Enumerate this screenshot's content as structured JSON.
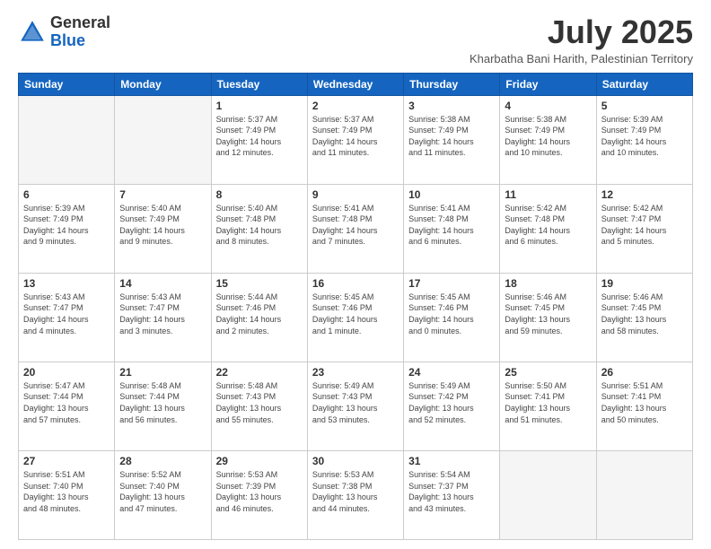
{
  "header": {
    "logo_general": "General",
    "logo_blue": "Blue",
    "month_title": "July 2025",
    "location": "Kharbatha Bani Harith, Palestinian Territory"
  },
  "weekdays": [
    "Sunday",
    "Monday",
    "Tuesday",
    "Wednesday",
    "Thursday",
    "Friday",
    "Saturday"
  ],
  "weeks": [
    [
      {
        "day": "",
        "info": ""
      },
      {
        "day": "",
        "info": ""
      },
      {
        "day": "1",
        "info": "Sunrise: 5:37 AM\nSunset: 7:49 PM\nDaylight: 14 hours\nand 12 minutes."
      },
      {
        "day": "2",
        "info": "Sunrise: 5:37 AM\nSunset: 7:49 PM\nDaylight: 14 hours\nand 11 minutes."
      },
      {
        "day": "3",
        "info": "Sunrise: 5:38 AM\nSunset: 7:49 PM\nDaylight: 14 hours\nand 11 minutes."
      },
      {
        "day": "4",
        "info": "Sunrise: 5:38 AM\nSunset: 7:49 PM\nDaylight: 14 hours\nand 10 minutes."
      },
      {
        "day": "5",
        "info": "Sunrise: 5:39 AM\nSunset: 7:49 PM\nDaylight: 14 hours\nand 10 minutes."
      }
    ],
    [
      {
        "day": "6",
        "info": "Sunrise: 5:39 AM\nSunset: 7:49 PM\nDaylight: 14 hours\nand 9 minutes."
      },
      {
        "day": "7",
        "info": "Sunrise: 5:40 AM\nSunset: 7:49 PM\nDaylight: 14 hours\nand 9 minutes."
      },
      {
        "day": "8",
        "info": "Sunrise: 5:40 AM\nSunset: 7:48 PM\nDaylight: 14 hours\nand 8 minutes."
      },
      {
        "day": "9",
        "info": "Sunrise: 5:41 AM\nSunset: 7:48 PM\nDaylight: 14 hours\nand 7 minutes."
      },
      {
        "day": "10",
        "info": "Sunrise: 5:41 AM\nSunset: 7:48 PM\nDaylight: 14 hours\nand 6 minutes."
      },
      {
        "day": "11",
        "info": "Sunrise: 5:42 AM\nSunset: 7:48 PM\nDaylight: 14 hours\nand 6 minutes."
      },
      {
        "day": "12",
        "info": "Sunrise: 5:42 AM\nSunset: 7:47 PM\nDaylight: 14 hours\nand 5 minutes."
      }
    ],
    [
      {
        "day": "13",
        "info": "Sunrise: 5:43 AM\nSunset: 7:47 PM\nDaylight: 14 hours\nand 4 minutes."
      },
      {
        "day": "14",
        "info": "Sunrise: 5:43 AM\nSunset: 7:47 PM\nDaylight: 14 hours\nand 3 minutes."
      },
      {
        "day": "15",
        "info": "Sunrise: 5:44 AM\nSunset: 7:46 PM\nDaylight: 14 hours\nand 2 minutes."
      },
      {
        "day": "16",
        "info": "Sunrise: 5:45 AM\nSunset: 7:46 PM\nDaylight: 14 hours\nand 1 minute."
      },
      {
        "day": "17",
        "info": "Sunrise: 5:45 AM\nSunset: 7:46 PM\nDaylight: 14 hours\nand 0 minutes."
      },
      {
        "day": "18",
        "info": "Sunrise: 5:46 AM\nSunset: 7:45 PM\nDaylight: 13 hours\nand 59 minutes."
      },
      {
        "day": "19",
        "info": "Sunrise: 5:46 AM\nSunset: 7:45 PM\nDaylight: 13 hours\nand 58 minutes."
      }
    ],
    [
      {
        "day": "20",
        "info": "Sunrise: 5:47 AM\nSunset: 7:44 PM\nDaylight: 13 hours\nand 57 minutes."
      },
      {
        "day": "21",
        "info": "Sunrise: 5:48 AM\nSunset: 7:44 PM\nDaylight: 13 hours\nand 56 minutes."
      },
      {
        "day": "22",
        "info": "Sunrise: 5:48 AM\nSunset: 7:43 PM\nDaylight: 13 hours\nand 55 minutes."
      },
      {
        "day": "23",
        "info": "Sunrise: 5:49 AM\nSunset: 7:43 PM\nDaylight: 13 hours\nand 53 minutes."
      },
      {
        "day": "24",
        "info": "Sunrise: 5:49 AM\nSunset: 7:42 PM\nDaylight: 13 hours\nand 52 minutes."
      },
      {
        "day": "25",
        "info": "Sunrise: 5:50 AM\nSunset: 7:41 PM\nDaylight: 13 hours\nand 51 minutes."
      },
      {
        "day": "26",
        "info": "Sunrise: 5:51 AM\nSunset: 7:41 PM\nDaylight: 13 hours\nand 50 minutes."
      }
    ],
    [
      {
        "day": "27",
        "info": "Sunrise: 5:51 AM\nSunset: 7:40 PM\nDaylight: 13 hours\nand 48 minutes."
      },
      {
        "day": "28",
        "info": "Sunrise: 5:52 AM\nSunset: 7:40 PM\nDaylight: 13 hours\nand 47 minutes."
      },
      {
        "day": "29",
        "info": "Sunrise: 5:53 AM\nSunset: 7:39 PM\nDaylight: 13 hours\nand 46 minutes."
      },
      {
        "day": "30",
        "info": "Sunrise: 5:53 AM\nSunset: 7:38 PM\nDaylight: 13 hours\nand 44 minutes."
      },
      {
        "day": "31",
        "info": "Sunrise: 5:54 AM\nSunset: 7:37 PM\nDaylight: 13 hours\nand 43 minutes."
      },
      {
        "day": "",
        "info": ""
      },
      {
        "day": "",
        "info": ""
      }
    ]
  ]
}
